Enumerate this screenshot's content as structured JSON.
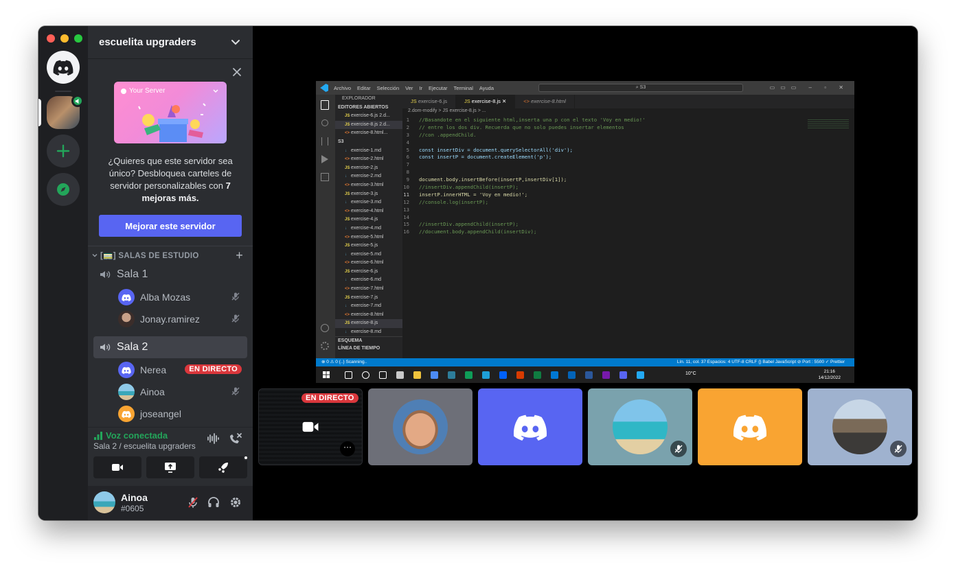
{
  "server": {
    "name": "escuelita upgraders"
  },
  "promo": {
    "card_title": "Your Server",
    "text_prefix": "¿Quieres que este servidor sea único? Desbloquea carteles de servidor personalizables con ",
    "text_bold": "7 mejoras más.",
    "button_label": "Mejorar este servidor"
  },
  "category": {
    "label": "[🚃] SALAS DE ESTUDIO"
  },
  "channels": [
    {
      "name": "Sala 1",
      "users": [
        {
          "name": "Alba Mozas",
          "muted": true
        },
        {
          "name": "Jonay.ramirez",
          "muted": true
        }
      ]
    },
    {
      "name": "Sala 2",
      "users": [
        {
          "name": "Nerea",
          "live": "EN DIRECTO"
        },
        {
          "name": "Ainoa",
          "muted": true
        },
        {
          "name": "joseangel"
        }
      ]
    }
  ],
  "voice": {
    "status": "Voz conectada",
    "location": "Sala 2 / escuelita upgraders"
  },
  "user": {
    "name": "Ainoa",
    "tag": "#0605"
  },
  "stream": {
    "live_label": "EN DIRECTO"
  },
  "vscode": {
    "menu": [
      "Archivo",
      "Editar",
      "Selección",
      "Ver",
      "Ir",
      "Ejecutar",
      "Terminal",
      "Ayuda"
    ],
    "search": "S3",
    "explorer_title": "EXPLORADOR",
    "open_editors_label": "EDITORES ABIERTOS",
    "open_editors": [
      "exercise-6.js 2.d...",
      "exercise-8.js 2.d...",
      "exercise-8.html..."
    ],
    "folder": "S3",
    "files": [
      "exercise-1.md",
      "exercise-2.html",
      "exercise-2.js",
      "exercise-2.md",
      "exercise-3.html",
      "exercise-3.js",
      "exercise-3.md",
      "exercise-4.html",
      "exercise-4.js",
      "exercise-4.md",
      "exercise-5.html",
      "exercise-5.js",
      "exercise-5.md",
      "exercise-6.html",
      "exercise-6.js",
      "exercise-6.md",
      "exercise-7.html",
      "exercise-7.js",
      "exercise-7.md",
      "exercise-8.html",
      "exercise-8.js",
      "exercise-8.md",
      "exercise-9.html"
    ],
    "outline_label": "ESQUEMA",
    "timeline_label": "LÍNEA DE TIEMPO",
    "tabs": [
      "exercise-6.js",
      "exercise-8.js",
      "exercise-8.html"
    ],
    "breadcrumb": "2.dom-modify > JS exercise-8.js > ...",
    "code": [
      "//Basandote en el siguiente html,inserta una p con el texto 'Voy en medio!'",
      "// entre los dos div. Recuerda que no solo puedes insertar elementos",
      "//con .appendChild.",
      "",
      "const insertDiv = document.querySelectorAll('div');",
      "const insertP = document.createElement('p');",
      "",
      "",
      "document.body.insertBefore(insertP,insertDiv[1]);",
      "//insertDiv.appendChild(insertP);",
      "insertP.innerHTML = 'Voy en medio!';",
      "//console.log(insertP);",
      "",
      "",
      "//insertDiv.appendChild(insertP);",
      "//document.body.appendChild(insertDiv);"
    ],
    "status_left": "⊗ 0 ⚠ 0    {..} Scanning..",
    "status_right": "Lín. 11, col. 37   Espacios: 4   UTF-8   CRLF   {} Babel JavaScript   ⊘ Port : 5500   ✓ Prettier",
    "weather": "10°C",
    "clock_time": "21:16",
    "clock_date": "14/12/2022"
  },
  "colors": {
    "accent": "#5865f2",
    "live": "#da373c",
    "voice_green": "#23a55a",
    "tile_orange": "#f9a432",
    "tile_blue": "#5865f2"
  }
}
